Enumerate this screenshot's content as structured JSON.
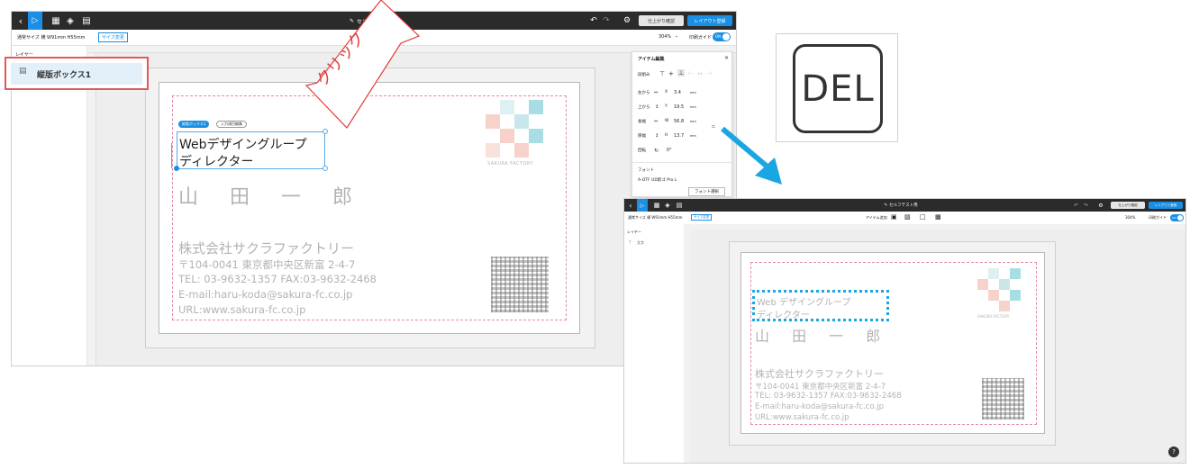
{
  "left": {
    "toolbar": {
      "title": "セルフテスト用",
      "confirm_label": "仕上がり確認",
      "register_label": "レイアウト登録"
    },
    "subbar": {
      "size_label": "通常サイズ 横 W91mm H55mm",
      "size_change": "サイズ変更",
      "zoom": "304%",
      "guide_label": "印刷ガイド",
      "toggle": "ON",
      "align_label": "整列"
    },
    "layers": {
      "header": "レイヤー",
      "item": "縦版ボックス1"
    },
    "card": {
      "tag1": "縦版ボックス1",
      "tag2": "入力項目編集",
      "title_line1": "Webデザイングループ",
      "title_line2": "ディレクター",
      "name": "山 田 一 郎",
      "company": "株式会社サクラファクトリー",
      "address": "〒104-0041 東京都中央区新富 2-4-7",
      "tel": "TEL: 03-9632-1357 FAX:03-9632-2468",
      "email": "E-mail:haru-koda@sakura-fc.co.jp",
      "url": "URL:www.sakura-fc.co.jp",
      "logo_text": "SAKURA FACTORY"
    },
    "panel": {
      "title": "アイテム編集",
      "close": "×",
      "align_label": "段組み",
      "rows": [
        {
          "label": "左から",
          "axis": "X",
          "value": "3.4",
          "unit": "mm"
        },
        {
          "label": "上から",
          "axis": "Y",
          "value": "19.5",
          "unit": "mm"
        },
        {
          "label": "長幅",
          "axis": "W",
          "value": "56.8",
          "unit": "mm"
        },
        {
          "label": "厚幅",
          "axis": "H",
          "value": "13.7",
          "unit": "mm"
        }
      ],
      "rotate_label": "回転",
      "rotate_value": "0°",
      "font_header": "フォント",
      "font_name": "A-OTF UD新ゴ Pro L",
      "font_button": "フォント選択"
    }
  },
  "callout": {
    "text": "クリック"
  },
  "del_key": {
    "label": "DEL"
  },
  "right": {
    "toolbar": {
      "title": "セルフテスト用",
      "confirm_label": "仕上がり確認",
      "register_label": "レイアウト登録"
    },
    "subbar": {
      "size_label": "通常サイズ 横 W91mm H55mm",
      "size_change": "サイズ変更",
      "item_select": "アイテム追加",
      "zoom": "304%",
      "guide_label": "印刷ガイド",
      "toggle": "ON"
    },
    "layers": {
      "header": "レイヤー",
      "item": "文字"
    },
    "card": {
      "title_line1": "Web デザイングループ",
      "title_line2": "ディレクター",
      "name": "山 田 一 郎",
      "company": "株式会社サクラファクトリー",
      "address": "〒104-0041 東京都中央区新富 2-4-7",
      "tel": "TEL: 03-9632-1357 FAX:03-9632-2468",
      "email": "E-mail:haru-koda@sakura-fc.co.jp",
      "url": "URL:www.sakura-fc.co.jp",
      "logo_text": "SAKURA FACTORY"
    },
    "help": "?"
  },
  "colors": {
    "accent": "#1a8fe3",
    "highlight_red": "#e05a5a",
    "arrow_blue": "#1aa6e3",
    "pink_guide": "#e38aa4",
    "callout_red": "#e23b3b"
  }
}
